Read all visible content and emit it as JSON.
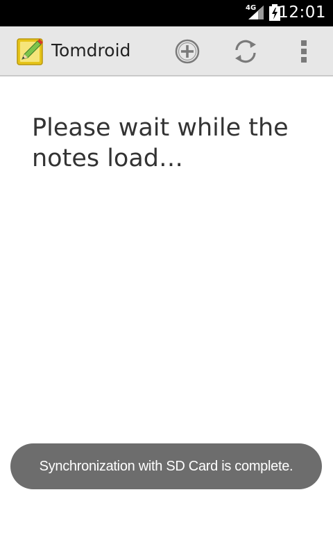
{
  "status_bar": {
    "network_type": "4G",
    "time": "12:01",
    "signal_icon": "signal-icon",
    "battery_icon": "battery-charging-icon"
  },
  "action_bar": {
    "app_icon": "notepad-pencil-icon",
    "title": "Tomdroid",
    "actions": [
      {
        "name": "add-note",
        "icon": "add-circle-icon"
      },
      {
        "name": "sync",
        "icon": "sync-icon"
      },
      {
        "name": "overflow-menu",
        "icon": "more-vertical-icon"
      }
    ]
  },
  "content": {
    "loading_message": "Please wait while the notes load…"
  },
  "toast": {
    "message": "Synchronization with SD Card is complete."
  },
  "colors": {
    "status_bar": "#000000",
    "action_bar": "#e7e7e7",
    "toast_bg": "#6d6d6d"
  }
}
